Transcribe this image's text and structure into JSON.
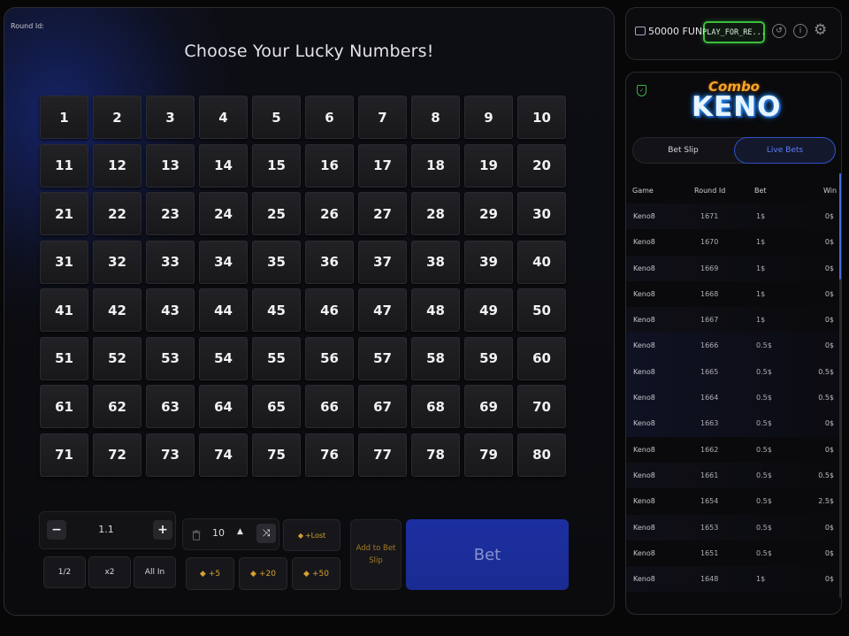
{
  "game": {
    "round_id_label": "Round Id:",
    "title": "Choose Your Lucky Numbers!",
    "numbers": [
      "1",
      "2",
      "3",
      "4",
      "5",
      "6",
      "7",
      "8",
      "9",
      "10",
      "11",
      "12",
      "13",
      "14",
      "15",
      "16",
      "17",
      "18",
      "19",
      "20",
      "21",
      "22",
      "23",
      "24",
      "25",
      "26",
      "27",
      "28",
      "29",
      "30",
      "31",
      "32",
      "33",
      "34",
      "35",
      "36",
      "37",
      "38",
      "39",
      "40",
      "41",
      "42",
      "43",
      "44",
      "45",
      "46",
      "47",
      "48",
      "49",
      "50",
      "51",
      "52",
      "53",
      "54",
      "55",
      "56",
      "57",
      "58",
      "59",
      "60",
      "61",
      "62",
      "63",
      "64",
      "65",
      "66",
      "67",
      "68",
      "69",
      "70",
      "71",
      "72",
      "73",
      "74",
      "75",
      "76",
      "77",
      "78",
      "79",
      "80"
    ]
  },
  "controls": {
    "stake_minus": "−",
    "stake_value": "1.1",
    "stake_plus": "+",
    "half": "1/2",
    "double": "x2",
    "all_in": "All In",
    "quick_pick_count": "10",
    "quick_pick_up": "▲",
    "shuffle_icon": "⤨",
    "plus_lost": "+Lost",
    "plus5": "+5",
    "plus20": "+20",
    "plus50": "+50",
    "add_to_bet_slip": "Add to Bet Slip",
    "bet": "Bet"
  },
  "header": {
    "balance": "50000 FUN",
    "mode": "PLAY_FOR_RE...",
    "history_icon": "history-icon",
    "info_icon": "info-icon",
    "settings_icon": "gear-icon"
  },
  "side": {
    "logo_top": "Combo",
    "logo_main": "KENO",
    "tabs": [
      "Bet Slip",
      "Live Bets"
    ],
    "active_tab": "Live Bets",
    "columns": [
      "Game",
      "Round Id",
      "Bet",
      "Win"
    ],
    "rows": [
      {
        "game": "Keno8",
        "round": "1671",
        "bet": "1$",
        "win": "0$"
      },
      {
        "game": "Keno8",
        "round": "1670",
        "bet": "1$",
        "win": "0$"
      },
      {
        "game": "Keno8",
        "round": "1669",
        "bet": "1$",
        "win": "0$"
      },
      {
        "game": "Keno8",
        "round": "1668",
        "bet": "1$",
        "win": "0$"
      },
      {
        "game": "Keno8",
        "round": "1667",
        "bet": "1$",
        "win": "0$"
      },
      {
        "game": "Keno8",
        "round": "1666",
        "bet": "0.5$",
        "win": "0$"
      },
      {
        "game": "Keno8",
        "round": "1665",
        "bet": "0.5$",
        "win": "0.5$"
      },
      {
        "game": "Keno8",
        "round": "1664",
        "bet": "0.5$",
        "win": "0.5$"
      },
      {
        "game": "Keno8",
        "round": "1663",
        "bet": "0.5$",
        "win": "0$"
      },
      {
        "game": "Keno8",
        "round": "1662",
        "bet": "0.5$",
        "win": "0$"
      },
      {
        "game": "Keno8",
        "round": "1661",
        "bet": "0.5$",
        "win": "0.5$"
      },
      {
        "game": "Keno8",
        "round": "1654",
        "bet": "0.5$",
        "win": "2.5$"
      },
      {
        "game": "Keno8",
        "round": "1653",
        "bet": "0.5$",
        "win": "0$"
      },
      {
        "game": "Keno8",
        "round": "1651",
        "bet": "0.5$",
        "win": "0$"
      },
      {
        "game": "Keno8",
        "round": "1648",
        "bet": "1$",
        "win": "0$"
      }
    ]
  },
  "colors": {
    "accent_blue": "#1c2fa0",
    "gold": "#d6a12d",
    "mode_green": "#3bbf3b",
    "tab_active": "#5d7dff"
  }
}
